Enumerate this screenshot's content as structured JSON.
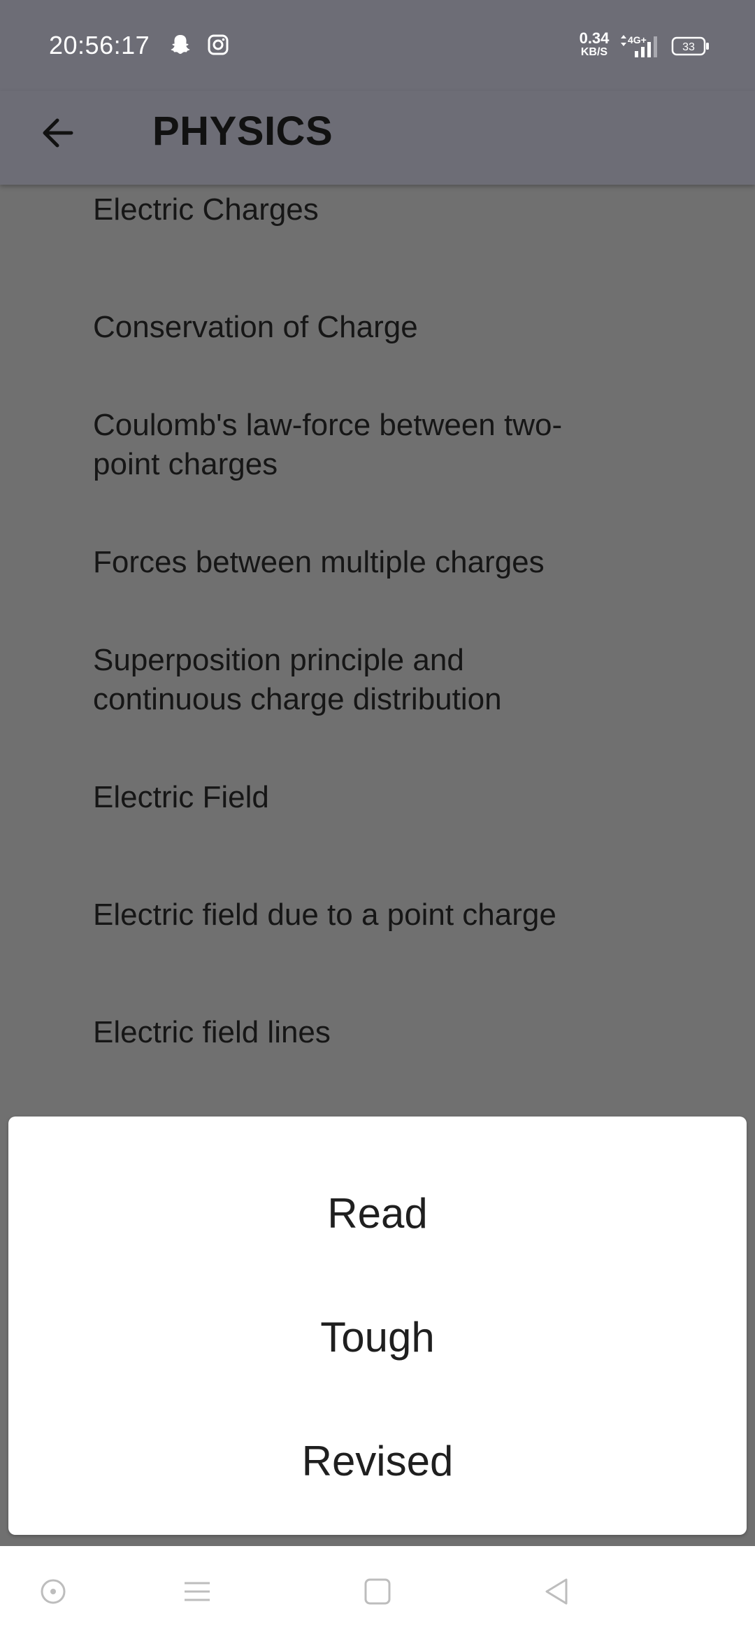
{
  "status_bar": {
    "time": "20:56:17",
    "net_speed_value": "0.34",
    "net_speed_unit": "KB/S",
    "network_type": "4G+",
    "battery_level": "33"
  },
  "app_bar": {
    "title": "PHYSICS"
  },
  "topics": [
    {
      "line1": "Electric Charges"
    },
    {
      "line1": "Conservation of Charge"
    },
    {
      "line1": "Coulomb's law-force between two-",
      "line2": "point charges"
    },
    {
      "line1": "Forces between multiple charges"
    },
    {
      "line1": "Superposition principle and",
      "line2": "continuous charge distribution"
    },
    {
      "line1": "Electric Field"
    },
    {
      "line1": "Electric field due to a point charge"
    },
    {
      "line1": "Electric field lines"
    }
  ],
  "sheet": {
    "options": [
      {
        "label": "Read"
      },
      {
        "label": "Tough"
      },
      {
        "label": "Revised"
      }
    ]
  },
  "icons": {
    "status": [
      "snapchat-icon",
      "instagram-icon"
    ],
    "nav": [
      "assistant-icon",
      "menu-icon",
      "home-icon",
      "back-nav-icon"
    ]
  },
  "colors": {
    "bar": "#6d6d76",
    "overlay": "#707070",
    "sheet": "#ffffff"
  }
}
